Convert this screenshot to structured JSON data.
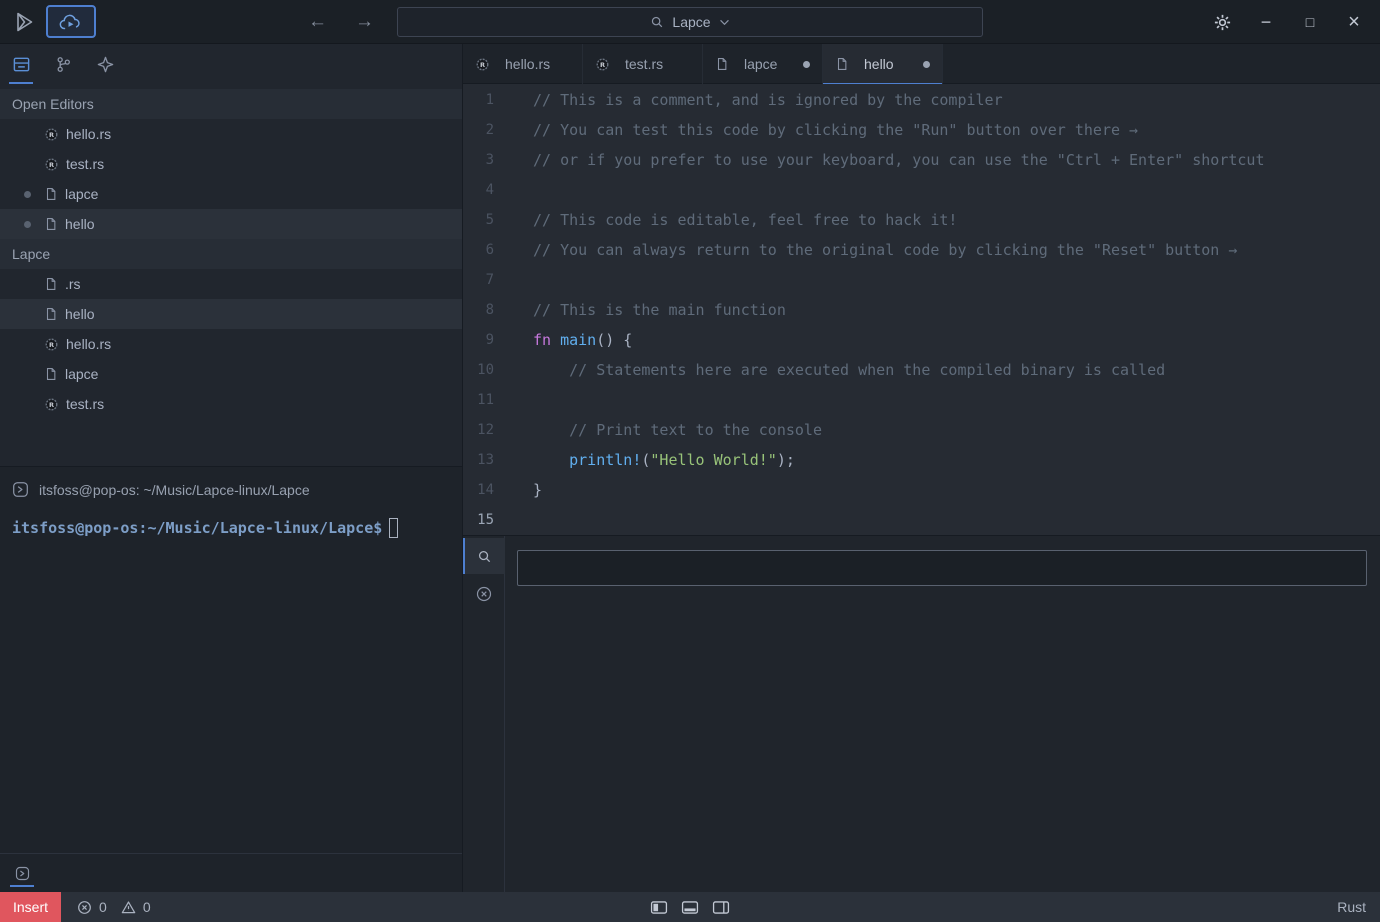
{
  "titlebar": {
    "palette_value": "Lapce",
    "back": "←",
    "forward": "→",
    "window_controls": {
      "minimize": "−",
      "maximize": "□",
      "close": "×"
    }
  },
  "activity_bar": {
    "tabs": [
      {
        "icon": "file-explorer-icon",
        "active": true
      },
      {
        "icon": "source-control-icon",
        "active": false
      },
      {
        "icon": "plugins-icon",
        "active": false
      }
    ]
  },
  "sidebar": {
    "open_editors_header": "Open Editors",
    "open_editors": [
      {
        "label": "hello.rs",
        "icon": "rust-file-icon",
        "modified": false,
        "selected": false
      },
      {
        "label": "test.rs",
        "icon": "rust-file-icon",
        "modified": false,
        "selected": false
      },
      {
        "label": "lapce",
        "icon": "file-icon",
        "modified": true,
        "selected": false
      },
      {
        "label": "hello",
        "icon": "file-icon",
        "modified": true,
        "selected": true
      }
    ],
    "workspace_header": "Lapce",
    "workspace_files": [
      {
        "label": ".rs",
        "icon": "file-icon",
        "modified": false,
        "selected": false
      },
      {
        "label": "hello",
        "icon": "file-icon",
        "modified": false,
        "selected": true
      },
      {
        "label": "hello.rs",
        "icon": "rust-file-icon",
        "modified": false,
        "selected": false
      },
      {
        "label": "lapce",
        "icon": "file-icon",
        "modified": false,
        "selected": false
      },
      {
        "label": "test.rs",
        "icon": "rust-file-icon",
        "modified": false,
        "selected": false
      }
    ]
  },
  "terminal": {
    "title": "itsfoss@pop-os: ~/Music/Lapce-linux/Lapce",
    "prompt": "itsfoss@pop-os:~/Music/Lapce-linux/Lapce$"
  },
  "editor": {
    "tabs": [
      {
        "label": "hello.rs",
        "icon": "rust-file-icon",
        "modified": false,
        "active": false
      },
      {
        "label": "test.rs",
        "icon": "rust-file-icon",
        "modified": false,
        "active": false
      },
      {
        "label": "lapce",
        "icon": "file-icon",
        "modified": true,
        "active": false
      },
      {
        "label": "hello",
        "icon": "file-icon",
        "modified": true,
        "active": true
      }
    ],
    "lines": [
      {
        "num": "1",
        "current": false,
        "tokens": [
          [
            "comment",
            "// This is a comment, and is ignored by the compiler"
          ]
        ]
      },
      {
        "num": "2",
        "current": false,
        "tokens": [
          [
            "comment",
            "// You can test this code by clicking the \"Run\" button over there →"
          ]
        ]
      },
      {
        "num": "3",
        "current": false,
        "tokens": [
          [
            "comment",
            "// or if you prefer to use your keyboard, you can use the \"Ctrl + Enter\" shortcut"
          ]
        ]
      },
      {
        "num": "4",
        "current": false,
        "tokens": []
      },
      {
        "num": "5",
        "current": false,
        "tokens": [
          [
            "comment",
            "// This code is editable, feel free to hack it!"
          ]
        ]
      },
      {
        "num": "6",
        "current": false,
        "tokens": [
          [
            "comment",
            "// You can always return to the original code by clicking the \"Reset\" button →"
          ]
        ]
      },
      {
        "num": "7",
        "current": false,
        "tokens": []
      },
      {
        "num": "8",
        "current": false,
        "tokens": [
          [
            "comment",
            "// This is the main function"
          ]
        ]
      },
      {
        "num": "9",
        "current": false,
        "tokens": [
          [
            "kw",
            "fn"
          ],
          [
            "plain",
            " "
          ],
          [
            "fn",
            "main"
          ],
          [
            "plain",
            "() {"
          ]
        ]
      },
      {
        "num": "10",
        "current": false,
        "tokens": [
          [
            "comment",
            "    // Statements here are executed when the compiled binary is called"
          ]
        ]
      },
      {
        "num": "11",
        "current": false,
        "tokens": []
      },
      {
        "num": "12",
        "current": false,
        "tokens": [
          [
            "comment",
            "    // Print text to the console"
          ]
        ]
      },
      {
        "num": "13",
        "current": false,
        "tokens": [
          [
            "plain",
            "    "
          ],
          [
            "fn",
            "println!"
          ],
          [
            "plain",
            "("
          ],
          [
            "str",
            "\"Hello World!\""
          ],
          [
            "plain",
            ");"
          ]
        ]
      },
      {
        "num": "14",
        "current": false,
        "tokens": [
          [
            "plain",
            "}"
          ]
        ]
      },
      {
        "num": "15",
        "current": true,
        "tokens": []
      }
    ]
  },
  "search_panel": {
    "input_value": ""
  },
  "statusbar": {
    "mode": "Insert",
    "error_count": "0",
    "warning_count": "0",
    "language": "Rust"
  },
  "colors": {
    "accent_blue": "#4e7fd0",
    "insert_mode_red": "#e0565e",
    "comment": "#5f6b7a",
    "keyword": "#c678dd",
    "function": "#61afef",
    "string": "#98c379"
  },
  "icons": {
    "lapce-logo-icon": "outlined play-triangle",
    "remote-cloud-icon": "cloud with play triangle",
    "back-icon": "←",
    "forward-icon": "→",
    "search-icon": "magnifier",
    "chevron-down-icon": "⌄",
    "gear-icon": "⚙",
    "minimize-icon": "−",
    "maximize-icon": "□",
    "close-icon": "×",
    "file-explorer-icon": "drawer cabinet",
    "source-control-icon": "git branch",
    "plugins-icon": "four-point spark",
    "rust-file-icon": "dark gear circle with R",
    "file-icon": "document outline",
    "terminal-icon": "rounded square with chevron",
    "error-icon": "circle with x",
    "warning-icon": "triangle with exclamation",
    "panel-left-icon": "square, left half filled",
    "panel-bottom-icon": "square, bottom half filled",
    "panel-right-icon": "square with right divider",
    "circle-cross-icon": "circle with x"
  }
}
